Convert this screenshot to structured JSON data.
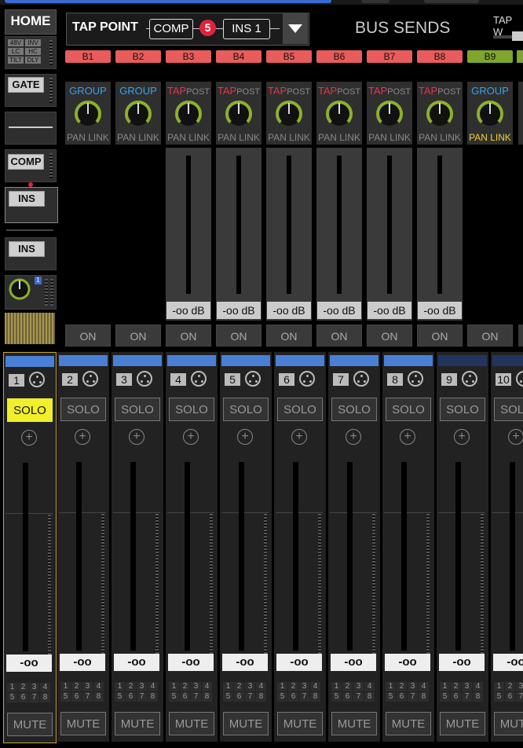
{
  "header": {
    "home": "HOME",
    "tap_point_label": "TAP POINT",
    "tap_options": [
      "COMP",
      "INS 1"
    ],
    "tap_number": "5",
    "panel_title": "BUS SENDS",
    "tap_w_label": "TAP W"
  },
  "side": {
    "tags": [
      "48V",
      "INV",
      "LC",
      "HC",
      "TILT",
      "DLY"
    ],
    "gate": "GATE",
    "comp": "COMP",
    "ins1": "INS",
    "ins2": "INS",
    "badge": "1"
  },
  "buses": [
    {
      "label": "B1",
      "color": "#e85c5c",
      "tap": "GROUP",
      "post": "",
      "pan": "PAN LINK",
      "db": ""
    },
    {
      "label": "B2",
      "color": "#e85c5c",
      "tap": "GROUP",
      "post": "",
      "pan": "PAN LINK",
      "db": ""
    },
    {
      "label": "B3",
      "color": "#e85c5c",
      "tap": "TAP",
      "post": "POST",
      "pan": "PAN LINK",
      "db": "-oo dB"
    },
    {
      "label": "B4",
      "color": "#e85c5c",
      "tap": "TAP",
      "post": "POST",
      "pan": "PAN LINK",
      "db": "-oo dB"
    },
    {
      "label": "B5",
      "color": "#e85c5c",
      "tap": "TAP",
      "post": "POST",
      "pan": "PAN LINK",
      "db": "-oo dB"
    },
    {
      "label": "B6",
      "color": "#e85c5c",
      "tap": "TAP",
      "post": "POST",
      "pan": "PAN LINK",
      "db": "-oo dB"
    },
    {
      "label": "B7",
      "color": "#e85c5c",
      "tap": "TAP",
      "post": "POST",
      "pan": "PAN LINK",
      "db": "-oo dB"
    },
    {
      "label": "B8",
      "color": "#e85c5c",
      "tap": "TAP",
      "post": "POST",
      "pan": "PAN LINK",
      "db": "-oo dB"
    },
    {
      "label": "B9",
      "color": "#7ea62c",
      "tap": "GROUP",
      "post": "",
      "pan": "PAN LINK",
      "db": ""
    }
  ],
  "on_label": "ON",
  "channels": [
    {
      "num": "1",
      "color": "#4a7fd6",
      "solo": "SOLO",
      "value": "-oo",
      "mute": "MUTE",
      "selected": true,
      "solo_on": true
    },
    {
      "num": "2",
      "color": "#4a7fd6",
      "solo": "SOLO",
      "value": "-oo",
      "mute": "MUTE"
    },
    {
      "num": "3",
      "color": "#4a7fd6",
      "solo": "SOLO",
      "value": "-oo",
      "mute": "MUTE"
    },
    {
      "num": "4",
      "color": "#4a7fd6",
      "solo": "SOLO",
      "value": "-oo",
      "mute": "MUTE"
    },
    {
      "num": "5",
      "color": "#4a7fd6",
      "solo": "SOLO",
      "value": "-oo",
      "mute": "MUTE"
    },
    {
      "num": "6",
      "color": "#4a7fd6",
      "solo": "SOLO",
      "value": "-oo",
      "mute": "MUTE"
    },
    {
      "num": "7",
      "color": "#4a7fd6",
      "solo": "SOLO",
      "value": "-oo",
      "mute": "MUTE"
    },
    {
      "num": "8",
      "color": "#4a7fd6",
      "solo": "SOLO",
      "value": "-oo",
      "mute": "MUTE"
    },
    {
      "num": "9",
      "color": "#23355f",
      "solo": "SOLO",
      "value": "-oo",
      "mute": "MUTE"
    },
    {
      "num": "10",
      "color": "#23355f",
      "solo": "SOLO",
      "value": "-oo",
      "mute": "MUTE"
    }
  ],
  "assign_numbers": [
    "1",
    "2",
    "3",
    "4",
    "5",
    "6",
    "7",
    "8"
  ]
}
